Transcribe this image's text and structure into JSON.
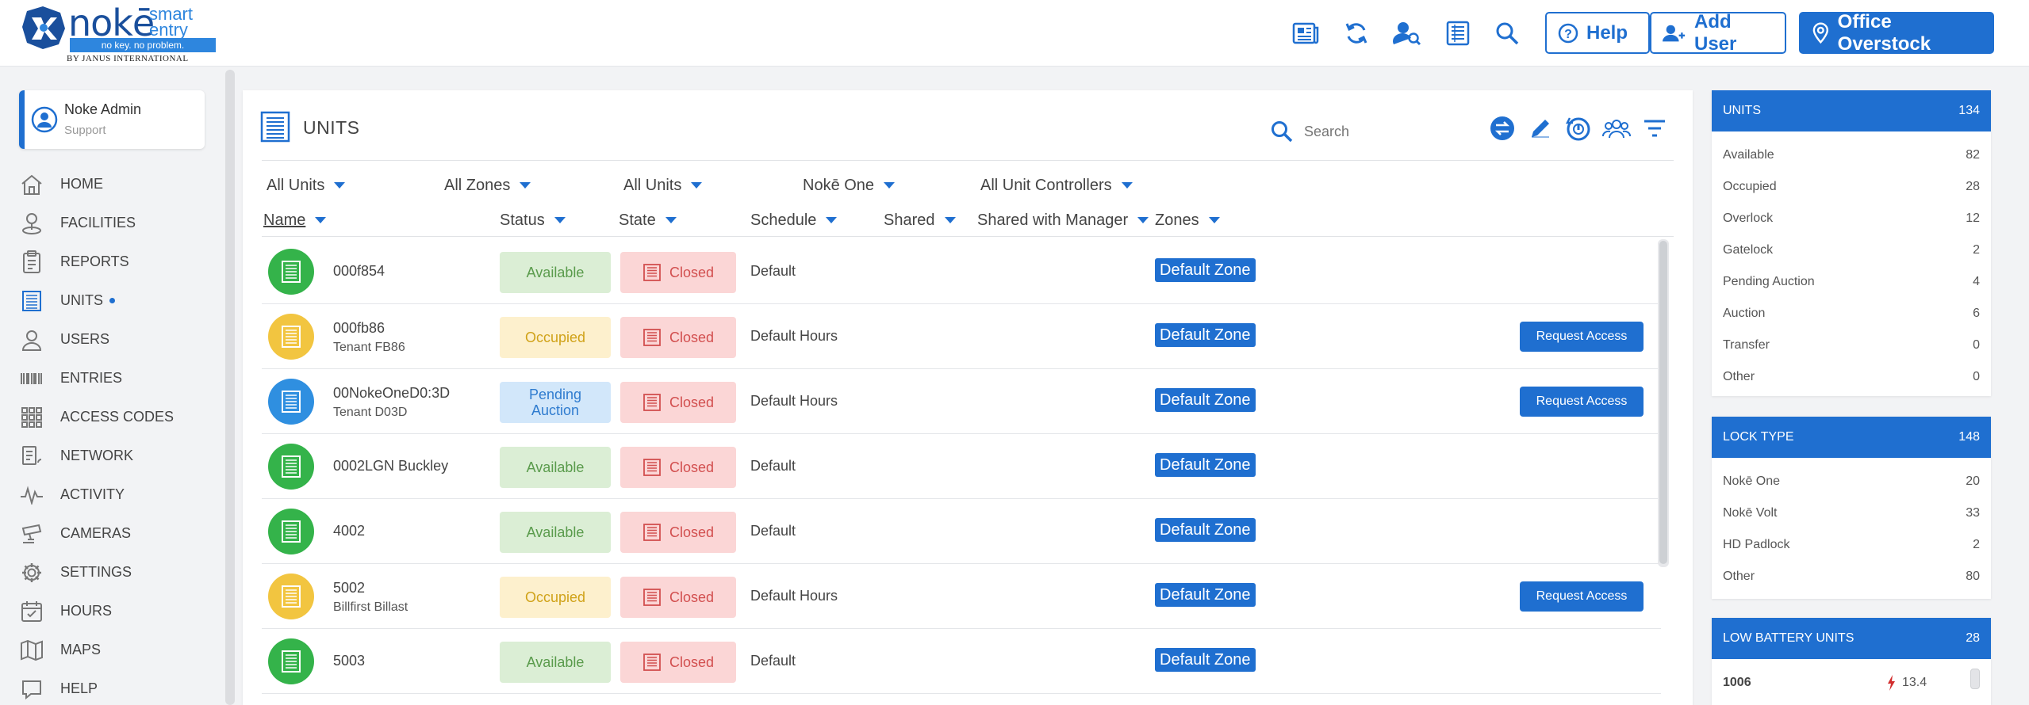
{
  "brand": {
    "wordmark": "nokē",
    "smart": "smart",
    "entry": "entry",
    "tagline": "no key. no problem.",
    "by": "BY JANUS INTERNATIONAL"
  },
  "header": {
    "icons": [
      "news-icon",
      "refresh-icon",
      "user-search-icon",
      "list-icon",
      "search-icon"
    ],
    "help_label": "Help",
    "add_user_label": "Add User",
    "facility_label": "Office Overstock"
  },
  "user": {
    "name": "Noke Admin",
    "role": "Support"
  },
  "nav": [
    {
      "label": "HOME",
      "icon": "home-icon"
    },
    {
      "label": "FACILITIES",
      "icon": "location-icon"
    },
    {
      "label": "REPORTS",
      "icon": "clipboard-icon"
    },
    {
      "label": "UNITS",
      "icon": "units-icon",
      "active": true
    },
    {
      "label": "USERS",
      "icon": "user-icon"
    },
    {
      "label": "ENTRIES",
      "icon": "barcode-icon"
    },
    {
      "label": "ACCESS CODES",
      "icon": "keypad-icon"
    },
    {
      "label": "NETWORK",
      "icon": "network-icon"
    },
    {
      "label": "ACTIVITY",
      "icon": "activity-icon"
    },
    {
      "label": "CAMERAS",
      "icon": "camera-icon"
    },
    {
      "label": "SETTINGS",
      "icon": "gear-icon"
    },
    {
      "label": "HOURS",
      "icon": "calendar-icon"
    },
    {
      "label": "MAPS",
      "icon": "map-icon"
    },
    {
      "label": "HELP",
      "icon": "help-icon"
    }
  ],
  "main": {
    "title": "UNITS",
    "search_placeholder": "Search",
    "filters": [
      "All Units",
      "All Zones",
      "All Units",
      "Nokē One",
      "All Unit Controllers"
    ],
    "columns": [
      "Name",
      "Status",
      "State",
      "Schedule",
      "Shared",
      "Shared with Manager",
      "Zones"
    ],
    "rows": [
      {
        "name": "000f854",
        "sub": "",
        "color": "green",
        "status": "Available",
        "status_type": "available",
        "state": "Closed",
        "schedule": "Default",
        "zone": "Default Zone",
        "request": ""
      },
      {
        "name": "000fb86",
        "sub": "Tenant FB86",
        "color": "yellow",
        "status": "Occupied",
        "status_type": "occupied",
        "state": "Closed",
        "schedule": "Default Hours",
        "zone": "Default Zone",
        "request": "Request Access"
      },
      {
        "name": "00NokeOneD0:3D",
        "sub": "Tenant D03D",
        "color": "blue",
        "status": "Pending Auction",
        "status_type": "pending",
        "state": "Closed",
        "schedule": "Default Hours",
        "zone": "Default Zone",
        "request": "Request Access"
      },
      {
        "name": "0002LGN Buckley",
        "sub": "",
        "color": "green",
        "status": "Available",
        "status_type": "available",
        "state": "Closed",
        "schedule": "Default",
        "zone": "Default Zone",
        "request": ""
      },
      {
        "name": "4002",
        "sub": "",
        "color": "green",
        "status": "Available",
        "status_type": "available",
        "state": "Closed",
        "schedule": "Default",
        "zone": "Default Zone",
        "request": ""
      },
      {
        "name": "5002",
        "sub": "Billfirst Billast",
        "color": "yellow",
        "status": "Occupied",
        "status_type": "occupied",
        "state": "Closed",
        "schedule": "Default Hours",
        "zone": "Default Zone",
        "request": "Request Access"
      },
      {
        "name": "5003",
        "sub": "",
        "color": "green",
        "status": "Available",
        "status_type": "available",
        "state": "Closed",
        "schedule": "Default",
        "zone": "Default Zone",
        "request": ""
      }
    ]
  },
  "panels": {
    "units": {
      "title": "UNITS",
      "total": "134",
      "rows": [
        {
          "label": "Available",
          "value": "82"
        },
        {
          "label": "Occupied",
          "value": "28"
        },
        {
          "label": "Overlock",
          "value": "12"
        },
        {
          "label": "Gatelock",
          "value": "2"
        },
        {
          "label": "Pending Auction",
          "value": "4"
        },
        {
          "label": "Auction",
          "value": "6"
        },
        {
          "label": "Transfer",
          "value": "0"
        },
        {
          "label": "Other",
          "value": "0"
        }
      ]
    },
    "lock_type": {
      "title": "LOCK TYPE",
      "total": "148",
      "rows": [
        {
          "label": "Nokē One",
          "value": "20"
        },
        {
          "label": "Nokē Volt",
          "value": "33"
        },
        {
          "label": "HD Padlock",
          "value": "2"
        },
        {
          "label": "Other",
          "value": "80"
        }
      ]
    },
    "low_battery": {
      "title": "LOW BATTERY UNITS",
      "total": "28",
      "rows": [
        {
          "unit": "1006",
          "value": "13.4"
        }
      ]
    }
  },
  "colors": {
    "primary": "#1f6fd0",
    "available": "#34b34a",
    "occupied": "#f2c540",
    "pending": "#2f8fe0",
    "closed": "#d24f4f"
  }
}
